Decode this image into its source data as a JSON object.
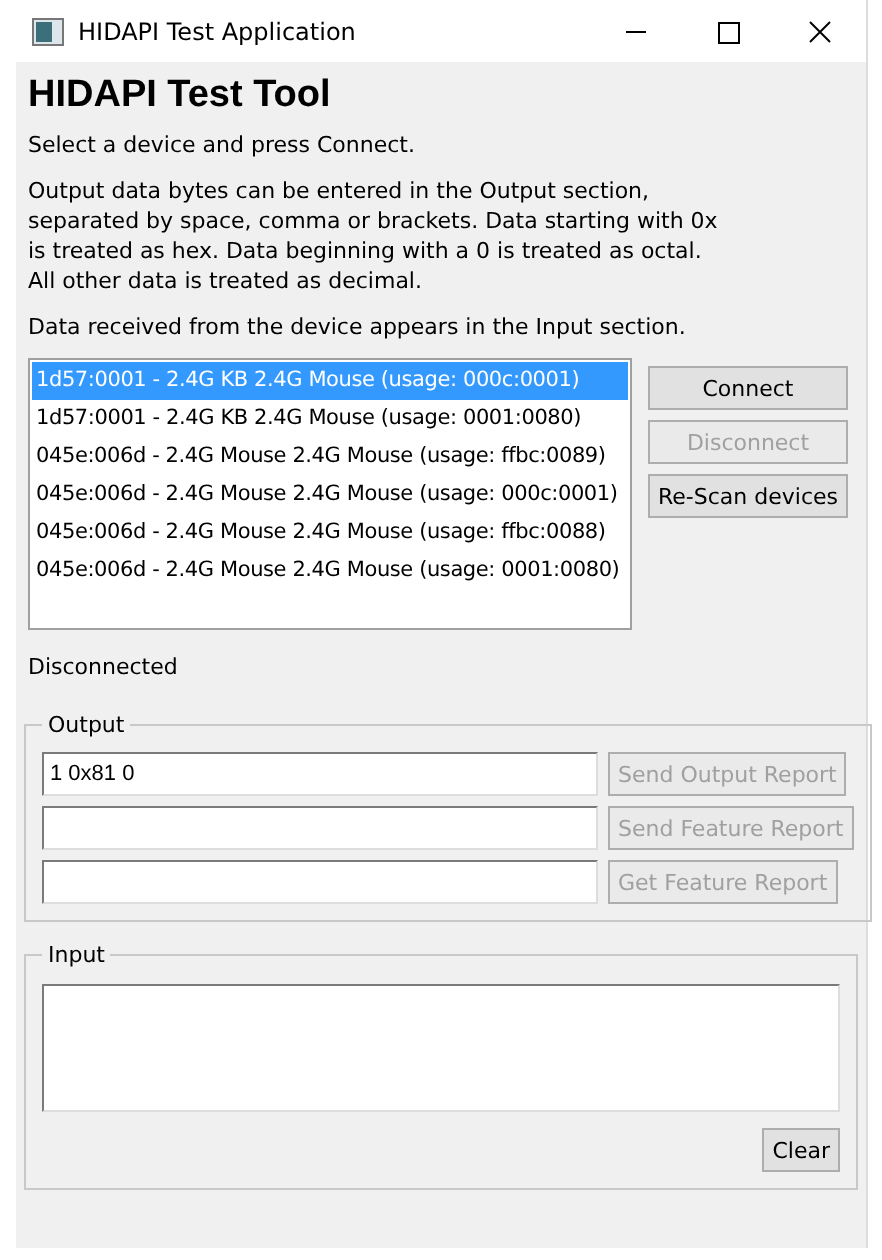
{
  "window": {
    "title": "HIDAPI Test Application"
  },
  "heading": "HIDAPI Test Tool",
  "paragraphs": [
    "Select a device and press Connect.",
    "Output data bytes can be entered in the Output section, separated by space, comma or brackets. Data starting with 0x is treated as hex. Data beginning with a 0 is treated as octal. All other data is treated as decimal.",
    "Data received from the device appears in the Input section."
  ],
  "devices": [
    {
      "label": "1d57:0001 - 2.4G KB 2.4G Mouse (usage: 000c:0001)",
      "selected": true
    },
    {
      "label": "1d57:0001 - 2.4G KB 2.4G Mouse (usage: 0001:0080)",
      "selected": false
    },
    {
      "label": "045e:006d - 2.4G Mouse 2.4G Mouse (usage: ffbc:0089)",
      "selected": false
    },
    {
      "label": "045e:006d - 2.4G Mouse 2.4G Mouse (usage: 000c:0001)",
      "selected": false
    },
    {
      "label": "045e:006d - 2.4G Mouse 2.4G Mouse (usage: ffbc:0088)",
      "selected": false
    },
    {
      "label": "045e:006d - 2.4G Mouse 2.4G Mouse (usage: 0001:0080)",
      "selected": false
    }
  ],
  "device_buttons": [
    {
      "label": "Connect",
      "disabled": false
    },
    {
      "label": "Disconnect",
      "disabled": true
    },
    {
      "label": "Re-Scan devices",
      "disabled": false
    }
  ],
  "status": "Disconnected",
  "output": {
    "title": "Output",
    "rows": [
      {
        "value": "1 0x81 0",
        "button": "Send Output Report",
        "disabled": true
      },
      {
        "button": "Send Feature Report",
        "disabled": true
      },
      {
        "button": "Get Feature Report",
        "disabled": true
      }
    ]
  },
  "input": {
    "title": "Input",
    "button": "Clear"
  }
}
